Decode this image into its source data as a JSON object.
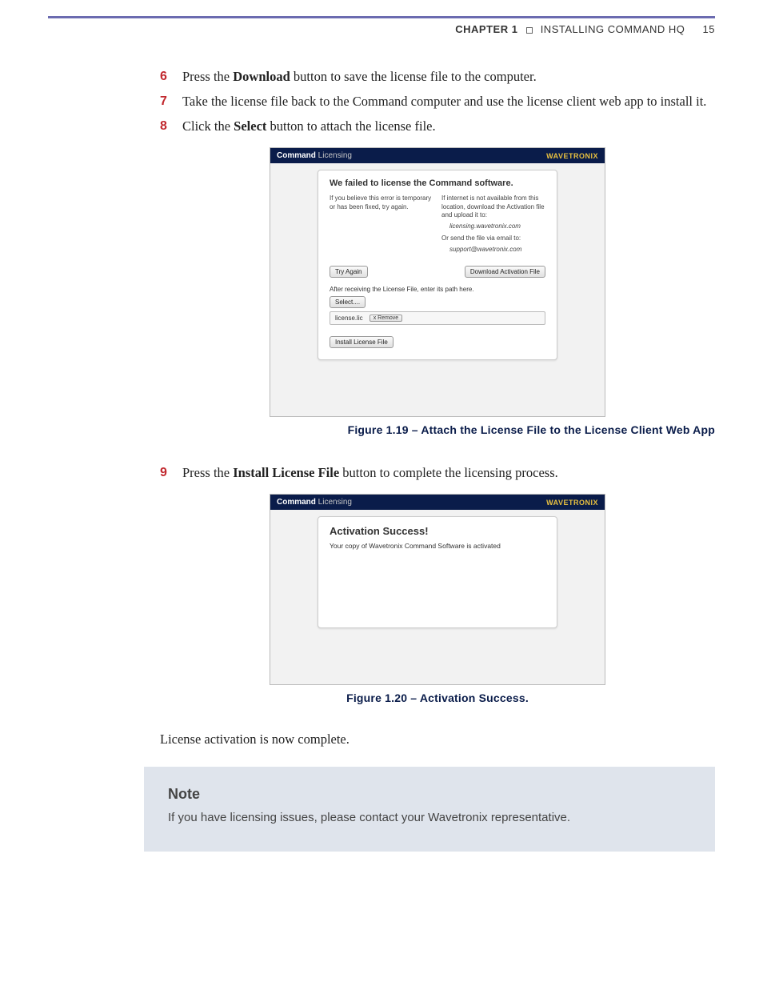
{
  "header": {
    "chapter_label": "CHAPTER 1",
    "chapter_title": "INSTALLING COMMAND HQ",
    "page_number": "15"
  },
  "steps": {
    "s6": {
      "num": "6",
      "pre": "Press the ",
      "bold": "Download",
      "post": " button to save the license file to the computer."
    },
    "s7": {
      "num": "7",
      "text": "Take the license file back to the Command computer and use the license client web app to install it."
    },
    "s8": {
      "num": "8",
      "pre": "Click the ",
      "bold": "Select",
      "post": " button to attach the license file."
    },
    "s9": {
      "num": "9",
      "pre": "Press the ",
      "bold": "Install License File",
      "post": " button to complete the licensing process."
    }
  },
  "fig1": {
    "titlebar_bold": "Command",
    "titlebar_light": " Licensing",
    "brand": "WAVETRONIX",
    "heading": "We failed to license the Command software.",
    "left_text": "If you believe this error is temporary or has been fixed, try again.",
    "right_text": "If internet is not available from this location, download the Activation file and upload it to:",
    "right_link": "licensing.wavetronix.com",
    "right_or": "Or send the file via email to:",
    "right_email": "support@wavetronix.com",
    "try_again": "Try Again",
    "download_btn": "Download Activation File",
    "after_label": "After receiving the License File, enter its path here.",
    "select_btn": "Select....",
    "file_name": "license.lic",
    "remove_btn": "x Remove",
    "install_btn": "Install License File",
    "caption": "Figure 1.19 – Attach the License File to the License Client Web App"
  },
  "fig2": {
    "titlebar_bold": "Command",
    "titlebar_light": " Licensing",
    "brand": "WAVETRONIX",
    "success_heading": "Activation Success!",
    "success_text": "Your copy of Wavetronix Command Software is activated",
    "caption": "Figure 1.20 – Activation Success."
  },
  "post_text": "License activation is now complete.",
  "note": {
    "title": "Note",
    "body": "If you have licensing issues, please contact your Wavetronix representative."
  }
}
